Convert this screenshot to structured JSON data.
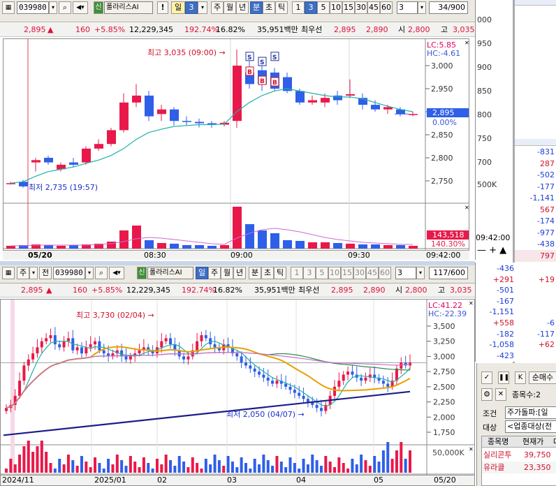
{
  "top": {
    "code": "039980",
    "sin": "신",
    "name": "폴라리스AI",
    "bang": "!",
    "period_label": "일",
    "period_value": "3",
    "btns": [
      "주",
      "월",
      "년",
      "분",
      "초",
      "틱"
    ],
    "nums": [
      "1",
      "3",
      "5",
      "10",
      "15",
      "30",
      "45",
      "60"
    ],
    "drop_value": "3",
    "counter": "34/900"
  },
  "info": {
    "price": "2,895",
    "arrow": "▲",
    "change": "160",
    "pct": "+5.85%",
    "volume": "12,229,345",
    "vratio": "192.74%",
    "turnover": "16.82%",
    "amount": "35,951백만",
    "best_label": "최우선",
    "ask": "2,895",
    "bid": "2,890",
    "open_label": "시",
    "open": "2,800",
    "high_label": "고",
    "high": "3,035"
  },
  "intraday": {
    "lc": "LC:5.85",
    "hc": "HC:-4.61",
    "yticks": [
      "3,000",
      "2,950",
      "2,900",
      "2,850",
      "2,800",
      "2,750"
    ],
    "price_tag": "2,895",
    "pct_tag": "0.00%",
    "max_label": "최고 3,035 (09:00) →",
    "min_label": "최저 2,735 (19:57)",
    "vol_tag1": "143,518",
    "vol_tag2": "140.30%",
    "xlabels": [
      "05/20",
      "08:30",
      "09:00",
      "09:30"
    ],
    "time_tag": "09:42:00",
    "signal_s": "S",
    "signal_b": "B"
  },
  "bottom": {
    "jusel": "주",
    "jeon": "전",
    "code": "039980",
    "sin": "신",
    "name": "폴라리스AI",
    "period_label": "일",
    "btns": [
      "주",
      "월",
      "년",
      "분",
      "초",
      "틱"
    ],
    "nums": [
      "1",
      "3",
      "5",
      "10",
      "15",
      "30",
      "45",
      "60"
    ],
    "drop_value": "3",
    "counter": "117/600"
  },
  "daily": {
    "lc": "LC:41.22",
    "hc": "HC:-22.39",
    "yticks": [
      "3,500",
      "3,250",
      "3,000",
      "2,750",
      "2,500",
      "2,250",
      "2,000",
      "1,750"
    ],
    "vol_tick": "50,000K",
    "max_label": "최고 3,730 (02/04) →",
    "min_label": "최저 2,050 (04/07) →",
    "xlabels": [
      "2024/11",
      "2025/01",
      "02",
      "03",
      "04",
      "05",
      "05/20"
    ]
  },
  "right_strip": {
    "top_vals": [
      "000",
      "950",
      "900",
      "850",
      "800",
      "750",
      "700",
      "500K"
    ],
    "list1": [
      "-831",
      "287",
      "-502",
      "-177",
      "-1,141",
      "567",
      "-174",
      "-977",
      "-438",
      "797"
    ],
    "time": "09:42:00",
    "list2a": [
      "-436",
      "+291",
      "-501",
      "-167",
      "-1,151",
      "+558",
      "-182",
      "-1,058",
      "-423"
    ],
    "list2b": [
      "",
      "+19",
      "",
      "",
      "",
      "-6",
      "-117",
      "+62",
      ""
    ]
  },
  "right_panel": {
    "top_btn": "순매수",
    "count_label": "종목수:2",
    "cond_label": "조건",
    "cond_value": "주가돌파:[일",
    "target_label": "대상",
    "target_value": "<업종대상(전",
    "headers": [
      "종목명",
      "현재가",
      "대"
    ],
    "rows": [
      {
        "name": "실리콘투",
        "price": "39,750"
      },
      {
        "name": "유라클",
        "price": "23,350"
      }
    ]
  },
  "colors": {
    "up": "#e8194a",
    "down": "#2f5fe8",
    "ma5": "#1fb0a8",
    "ma20": "#e8a000",
    "ma60": "#2a8a40",
    "ma120": "#cf6ad0",
    "trend": "#1c1c8c"
  }
}
